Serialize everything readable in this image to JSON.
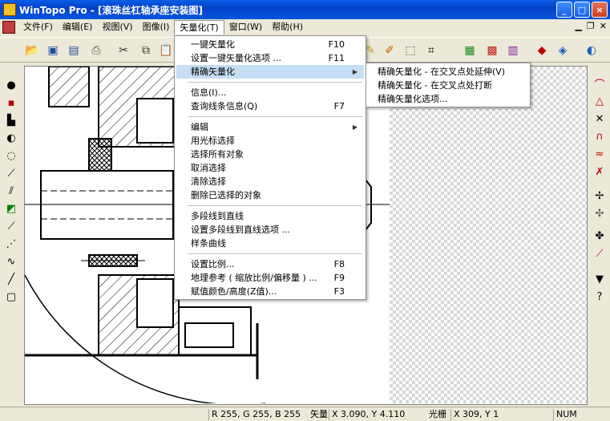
{
  "window": {
    "title": "WinTopo Pro - [滚珠丝杠轴承座安装图]",
    "buttons": [
      "0",
      "1",
      "r"
    ]
  },
  "menubar": {
    "items": [
      {
        "label": "文件(F)"
      },
      {
        "label": "编辑(E)"
      },
      {
        "label": "视图(V)"
      },
      {
        "label": "图像(I)"
      },
      {
        "label": "矢量化(T)"
      },
      {
        "label": "窗口(W)"
      },
      {
        "label": "帮助(H)"
      }
    ],
    "mdi_buttons": [
      "_",
      "ð",
      "×"
    ]
  },
  "dropdown": {
    "items": [
      {
        "label": "一键矢量化",
        "shortcut": "F10"
      },
      {
        "label": "设置一键矢量化选项 ...",
        "shortcut": "F11"
      },
      {
        "label": "精确矢量化",
        "shortcut": ""
      },
      {
        "label": "信息(I)...",
        "shortcut": ""
      },
      {
        "label": "查询线条信息(Q)",
        "shortcut": "F7"
      },
      {
        "label": "编辑",
        "shortcut": ""
      },
      {
        "label": "用光标选择",
        "shortcut": ""
      },
      {
        "label": "选择所有对象",
        "shortcut": ""
      },
      {
        "label": "取消选择",
        "shortcut": ""
      },
      {
        "label": "清除选择",
        "shortcut": ""
      },
      {
        "label": "删除已选择的对象",
        "shortcut": ""
      },
      {
        "label": "多段线到直线",
        "shortcut": ""
      },
      {
        "label": "设置多段线到直线选项 ...",
        "shortcut": ""
      },
      {
        "label": "样条曲线",
        "shortcut": ""
      },
      {
        "label": "设置比例...",
        "shortcut": "F8"
      },
      {
        "label": "地理参考 ( 缩放比例/偏移量 ) ...",
        "shortcut": "F9"
      },
      {
        "label": "赋值颜色/高度(Z值)...",
        "shortcut": "F3"
      }
    ]
  },
  "submenu": {
    "items": [
      {
        "label": "精确矢量化 - 在交叉点处延伸(V)"
      },
      {
        "label": "精确矢量化 - 在交叉点处打断"
      },
      {
        "label": "精确矢量化选项..."
      }
    ]
  },
  "status": {
    "rgb": "R 255, G 255, B 255",
    "mode": "矢量",
    "coords": "X 3.090, Y 4.110",
    "raster_label": "光栅",
    "raster_coords": "X 309, Y 1",
    "num": "NUM"
  },
  "colors": {
    "titlebar": "#0a56dc",
    "menu_highlight": "#c5def5",
    "background": "#ece9d8"
  }
}
